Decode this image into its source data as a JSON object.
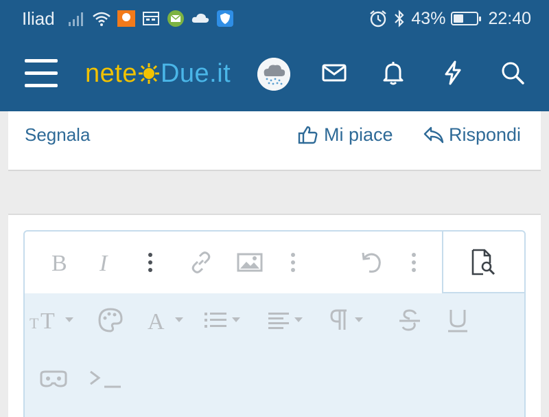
{
  "status_bar": {
    "carrier": "Iliad",
    "battery_percent": "43%",
    "battery_level": 0.43,
    "time": "22:40",
    "left_icons": [
      "signal-icon",
      "wifi-icon",
      "app-notification-icon",
      "calendar-icon",
      "mail-app-icon",
      "cloud-icon",
      "shield-app-icon"
    ],
    "right_icons": [
      "alarm-icon",
      "bluetooth-icon",
      "battery-icon"
    ]
  },
  "header": {
    "logo_part1": "nete",
    "logo_part2": "Due.it",
    "icons": [
      "menu-icon",
      "avatar",
      "mail-icon",
      "bell-icon",
      "bolt-icon",
      "search-icon"
    ]
  },
  "post_actions": {
    "report_label": "Segnala",
    "like_label": "Mi piace",
    "reply_label": "Rispondi"
  },
  "editor": {
    "toolbar_row1": [
      "bold-icon",
      "italic-icon",
      "more-vertical-icon",
      "link-icon",
      "image-icon",
      "more-vertical-icon",
      "undo-icon",
      "more-vertical-icon"
    ],
    "preview_icon": "preview-search-icon",
    "toolbar_row2": [
      "font-size-icon",
      "palette-icon",
      "text-color-icon",
      "list-icon",
      "align-icon",
      "paragraph-icon",
      "strikethrough-icon",
      "underline-icon",
      "spoiler-icon",
      "code-icon"
    ]
  },
  "colors": {
    "brand": "#1d5b8c",
    "link": "#2e6a97",
    "toolbar_bg": "#e7f1f8",
    "icon_muted": "#b9bdc1"
  }
}
